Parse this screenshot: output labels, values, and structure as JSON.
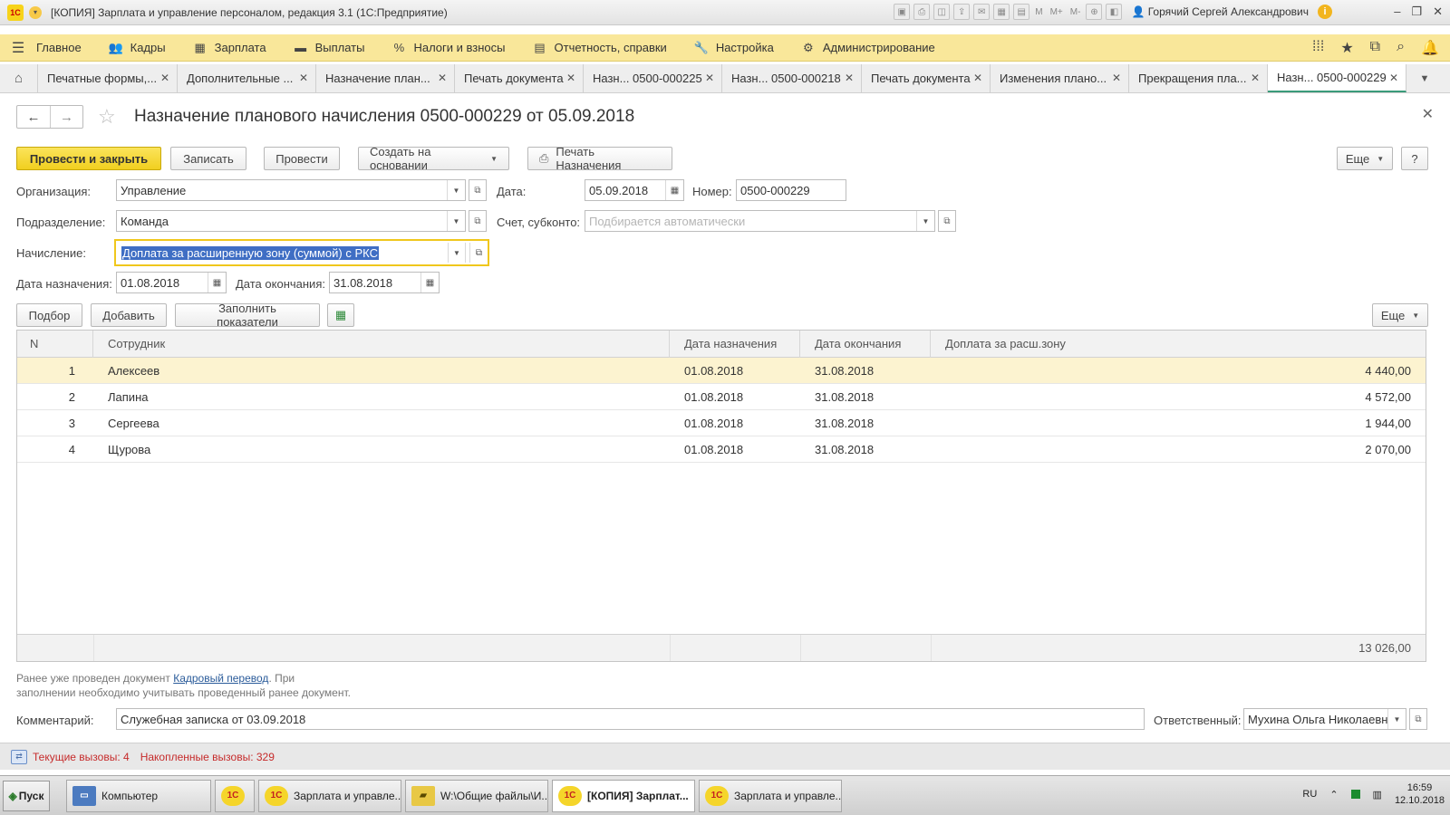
{
  "window": {
    "title": "[КОПИЯ] Зарплата и управление персоналом, редакция 3.1  (1С:Предприятие)",
    "logo": "1С",
    "user": "Горячий Сергей Александрович",
    "tools": [
      "M",
      "M+",
      "M-"
    ]
  },
  "menu": {
    "items": [
      {
        "label": "Главное",
        "icon": "menu-lines-icon"
      },
      {
        "label": "Кадры",
        "icon": "people-icon"
      },
      {
        "label": "Зарплата",
        "icon": "calculator-icon"
      },
      {
        "label": "Выплаты",
        "icon": "wallet-icon"
      },
      {
        "label": "Налоги и взносы",
        "icon": "percent-icon"
      },
      {
        "label": "Отчетность, справки",
        "icon": "report-icon"
      },
      {
        "label": "Настройка",
        "icon": "wrench-icon"
      },
      {
        "label": "Администрирование",
        "icon": "gear-icon"
      }
    ]
  },
  "tabs": [
    {
      "label": "Печатные формы,..."
    },
    {
      "label": "Дополнительные ..."
    },
    {
      "label": "Назначение план..."
    },
    {
      "label": "Печать документа"
    },
    {
      "label": "Назн... 0500-000225"
    },
    {
      "label": "Назн... 0500-000218"
    },
    {
      "label": "Печать документа"
    },
    {
      "label": "Изменения плано..."
    },
    {
      "label": "Прекращения пла..."
    },
    {
      "label": "Назн... 0500-000229"
    }
  ],
  "document": {
    "title": "Назначение планового начисления 0500-000229 от 05.09.2018"
  },
  "commands": {
    "post_close": "Провести и закрыть",
    "save": "Записать",
    "post": "Провести",
    "create_based": "Создать на основании",
    "print": "Печать Назначения",
    "more": "Еще",
    "help": "?"
  },
  "form": {
    "org_label": "Организация:",
    "org_value": "Управление",
    "date_label": "Дата:",
    "date_value": "05.09.2018",
    "number_label": "Номер:",
    "number_value": "0500-000229",
    "dept_label": "Подразделение:",
    "dept_value": "Команда",
    "account_label": "Счет, субконто:",
    "account_placeholder": "Подбирается автоматически",
    "accrual_label": "Начисление:",
    "accrual_value": "Доплата за расширенную зону (суммой) с РКС",
    "start_label": "Дата назначения:",
    "start_value": "01.08.2018",
    "end_label": "Дата окончания:",
    "end_value": "31.08.2018"
  },
  "table_commands": {
    "pick": "Подбор",
    "add": "Добавить",
    "fill": "Заполнить показатели",
    "more": "Еще"
  },
  "table": {
    "headers": [
      "N",
      "Сотрудник",
      "Дата назначения",
      "Дата окончания",
      "Доплата за расш.зону"
    ],
    "rows": [
      {
        "n": "1",
        "employee": "Алексеев",
        "start": "01.08.2018",
        "end": "31.08.2018",
        "amount": "4 440,00"
      },
      {
        "n": "2",
        "employee": "Лапина",
        "start": "01.08.2018",
        "end": "31.08.2018",
        "amount": "4 572,00"
      },
      {
        "n": "3",
        "employee": "Сергеева",
        "start": "01.08.2018",
        "end": "31.08.2018",
        "amount": "1 944,00"
      },
      {
        "n": "4",
        "employee": "Щурова",
        "start": "01.08.2018",
        "end": "31.08.2018",
        "amount": "2 070,00"
      }
    ],
    "total": "13 026,00"
  },
  "note": {
    "before": "Ранее уже проведен документ ",
    "link": "Кадровый перевод",
    "after": ". При",
    "line2": "заполнении необходимо учитывать проведенный ранее документ."
  },
  "footer": {
    "comment_label": "Комментарий:",
    "comment_value": "Служебная записка от 03.09.2018",
    "responsible_label": "Ответственный:",
    "responsible_value": "Мухина Ольга Николаевна"
  },
  "status": {
    "current": "Текущие вызовы: 4",
    "accumulated": "Накопленные вызовы: 329"
  },
  "taskbar": {
    "start": "Пуск",
    "items": [
      {
        "label": "Компьютер"
      },
      {
        "label": ""
      },
      {
        "label": "Зарплата и управле..."
      },
      {
        "label": "W:\\Общие файлы\\И..."
      },
      {
        "label": "[КОПИЯ] Зарплат..."
      },
      {
        "label": "Зарплата и управле..."
      }
    ],
    "lang": "RU",
    "time": "16:59",
    "date": "12.10.2018"
  }
}
